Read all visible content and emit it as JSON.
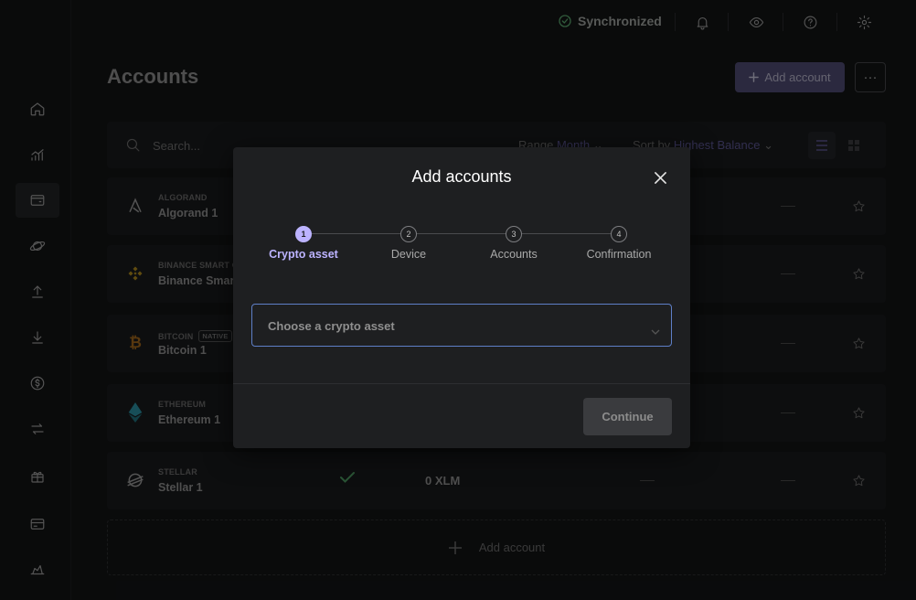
{
  "topbar": {
    "sync_label": "Synchronized",
    "icons": [
      "bell-icon",
      "eye-icon",
      "help-icon",
      "gear-icon"
    ]
  },
  "sidebar": {
    "items": [
      {
        "name": "home",
        "icon": "home-icon"
      },
      {
        "name": "market",
        "icon": "chart-icon"
      },
      {
        "name": "accounts",
        "icon": "wallet-icon",
        "active": true
      },
      {
        "name": "discover",
        "icon": "planet-icon"
      },
      {
        "name": "send",
        "icon": "upload-icon"
      },
      {
        "name": "receive",
        "icon": "download-icon"
      },
      {
        "name": "buy-sell",
        "icon": "dollar-icon"
      },
      {
        "name": "swap",
        "icon": "swap-icon"
      },
      {
        "name": "refer",
        "icon": "gift-icon"
      },
      {
        "name": "card",
        "icon": "card-icon"
      },
      {
        "name": "earn",
        "icon": "stake-icon"
      }
    ]
  },
  "main": {
    "title": "Accounts",
    "add_account_label": "Add account",
    "search_placeholder": "Search...",
    "range_label": "Range",
    "range_value": "Month",
    "sort_label": "Sort by",
    "sort_value": "Highest Balance",
    "add_account_bottom_label": "Add account"
  },
  "accounts": [
    {
      "ticker": "ALGORAND",
      "name": "Algorand 1",
      "icon": "algorand-icon",
      "color": "#9a9a9a"
    },
    {
      "ticker": "BINANCE SMART C",
      "name": "Binance Smart",
      "icon": "bnb-icon",
      "color": "#b08a1c"
    },
    {
      "ticker": "BITCOIN",
      "badge": "NATIVE",
      "name": "Bitcoin 1",
      "icon": "bitcoin-icon",
      "color": "#a0661c"
    },
    {
      "ticker": "ETHEREUM",
      "name": "Ethereum 1",
      "icon": "ethereum-icon",
      "color": "#2a8ea0"
    },
    {
      "ticker": "STELLAR",
      "name": "Stellar 1",
      "icon": "stellar-icon",
      "color": "#9a9a9a",
      "balance": "0 XLM"
    }
  ],
  "modal": {
    "title": "Add accounts",
    "steps": [
      {
        "num": "1",
        "label": "Crypto asset",
        "active": true
      },
      {
        "num": "2",
        "label": "Device"
      },
      {
        "num": "3",
        "label": "Accounts"
      },
      {
        "num": "4",
        "label": "Confirmation"
      }
    ],
    "select_placeholder": "Choose a crypto asset",
    "continue_label": "Continue"
  },
  "colors": {
    "accent": "#bcb3ff",
    "sync_green": "#5aa66d",
    "select_border": "#5e7fc7"
  }
}
